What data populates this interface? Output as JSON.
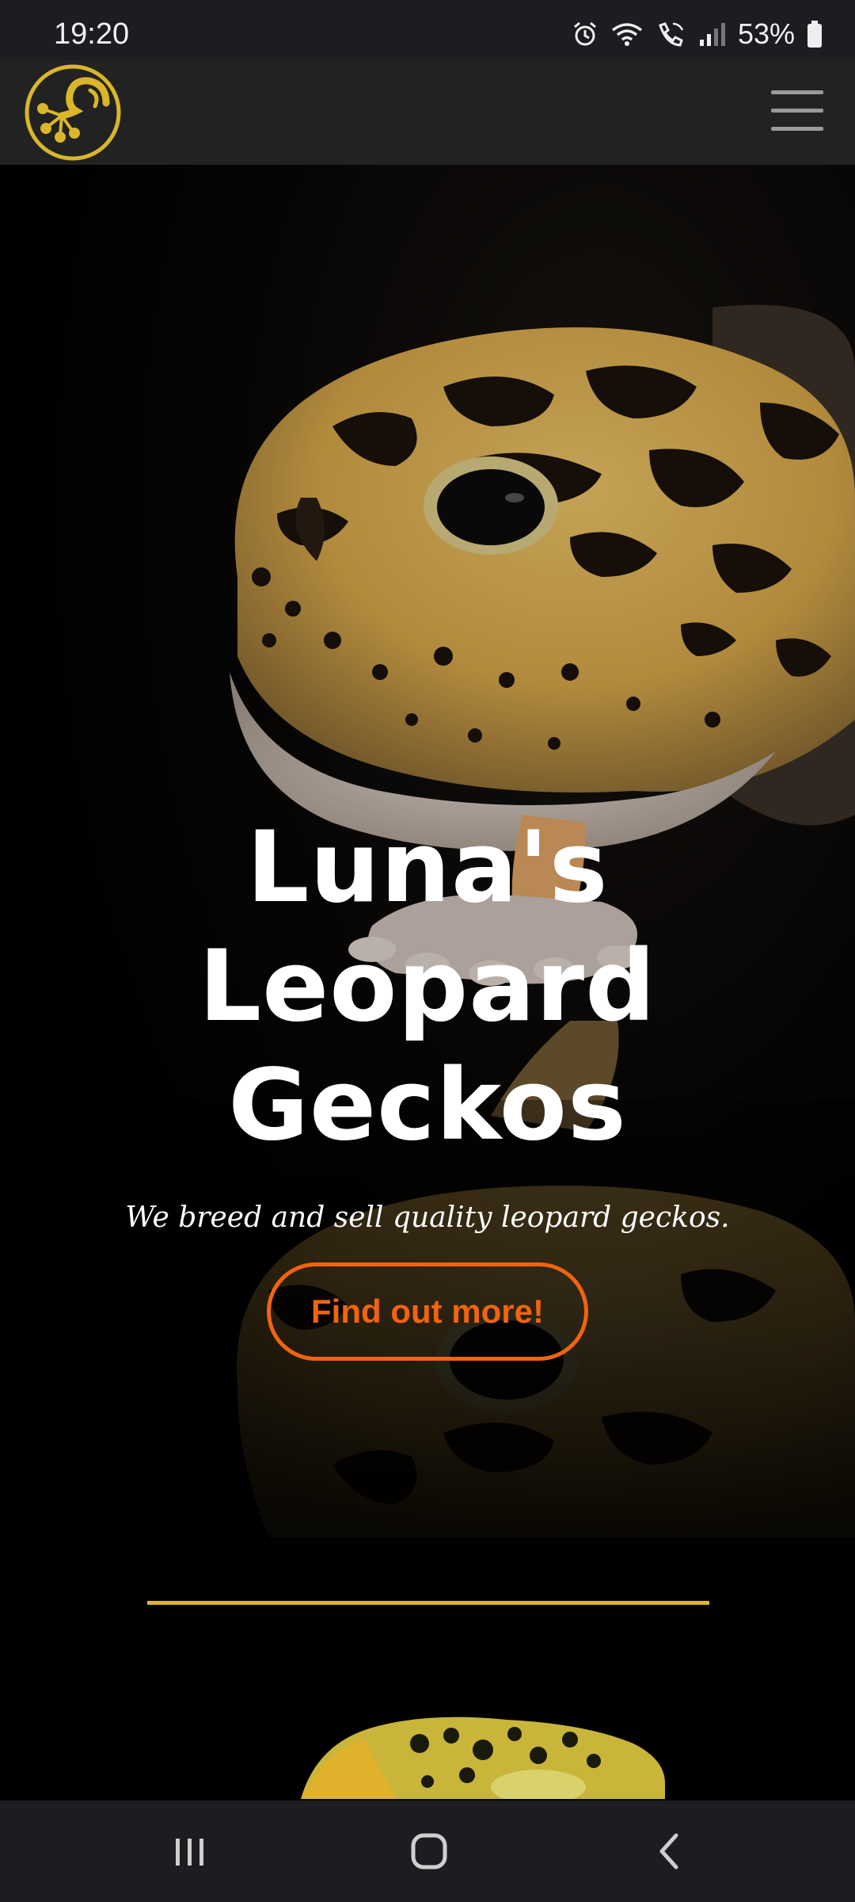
{
  "status_bar": {
    "time": "19:20",
    "battery": "53%",
    "icons": [
      "alarm-icon",
      "wifi-icon",
      "wifi-call-icon",
      "signal-icon",
      "battery-icon"
    ]
  },
  "header": {
    "logo": "gecko-logo",
    "menu_icon": "hamburger-menu-icon"
  },
  "hero": {
    "title_line1": "Luna's",
    "title_line2": "Leopard",
    "title_line3": "Geckos",
    "subtitle": "We breed and sell quality leopard geckos.",
    "cta_label": "Find out more!"
  },
  "nav_bar": {
    "buttons": [
      "recent-apps-icon",
      "home-icon",
      "back-icon"
    ]
  },
  "colors": {
    "accent_yellow": "#d9b62a",
    "cta_orange": "#f0640f",
    "header_bg": "#222222",
    "system_bar_bg": "#1b1d20"
  }
}
